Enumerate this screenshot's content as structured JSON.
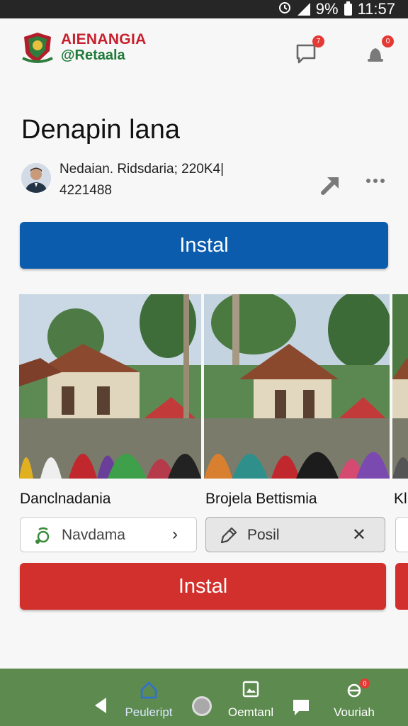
{
  "status_bar": {
    "battery_percent": "9%",
    "time": "11:57"
  },
  "header": {
    "brand_line1": "AIENANGIA",
    "brand_line2": "@Retaala",
    "chat_badge": "7",
    "bell_badge": "0"
  },
  "page": {
    "title": "Denapin lana",
    "meta_line1": "Nedaian. Ridsdaria; 220K4|",
    "meta_line2": "4221488",
    "install_label": "Instal"
  },
  "cards": [
    {
      "title": "Danclnadania",
      "chip_label": "Navdama",
      "chip_icon": "location-icon",
      "chip_trail": "›"
    },
    {
      "title": "Brojela Bettismia",
      "chip_label": "Posil",
      "chip_icon": "pencil-icon",
      "chip_trail": "✕"
    },
    {
      "title": "Kl",
      "chip_label": ""
    }
  ],
  "secondary_install_label": "Instal",
  "bottom_nav": {
    "items": [
      {
        "label": "Peuleript",
        "icon": "home-icon"
      },
      {
        "label": "Oemtanl",
        "icon": "gallery-icon"
      },
      {
        "label": "",
        "icon": "chat-icon"
      },
      {
        "label": "Vouriah",
        "icon": "plugin-icon",
        "badge": "0"
      }
    ]
  },
  "colors": {
    "primary_blue": "#0b5cad",
    "install_red": "#d2302c",
    "nav_green": "#5d8a4f",
    "brand_red": "#c8202e",
    "brand_green": "#1f7a3a"
  }
}
